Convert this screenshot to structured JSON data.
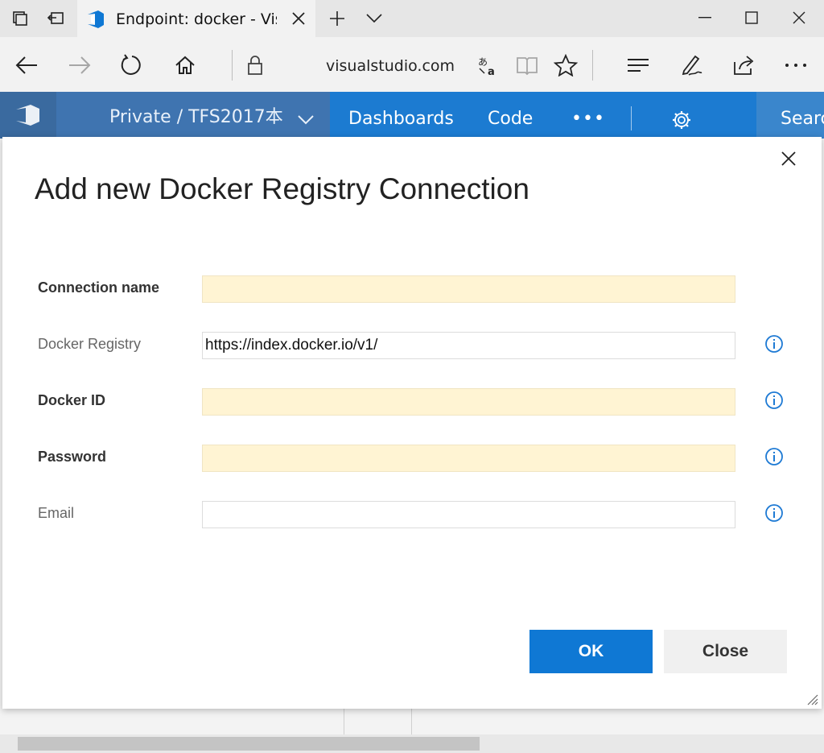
{
  "browser": {
    "tab_title": "Endpoint: docker - Visual Studio",
    "address": "visualstudio.com"
  },
  "app_header": {
    "project": "Private / TFS2017本",
    "hub_links": [
      "Dashboards",
      "Code"
    ],
    "more": "•••",
    "search": "Search"
  },
  "dialog": {
    "title": "Add new Docker Registry Connection",
    "fields": [
      {
        "label": "Connection name",
        "value": "",
        "required": true,
        "info": false
      },
      {
        "label": "Docker Registry",
        "value": "https://index.docker.io/v1/",
        "required": false,
        "info": true
      },
      {
        "label": "Docker ID",
        "value": "",
        "required": true,
        "info": true
      },
      {
        "label": "Password",
        "value": "",
        "required": true,
        "info": true
      },
      {
        "label": "Email",
        "value": "",
        "required": false,
        "info": true
      }
    ],
    "ok_label": "OK",
    "close_label": "Close"
  },
  "colors": {
    "accent": "#0f78d4",
    "required_field": "#fff4d3",
    "hub_bar": "#1c7bd1"
  }
}
